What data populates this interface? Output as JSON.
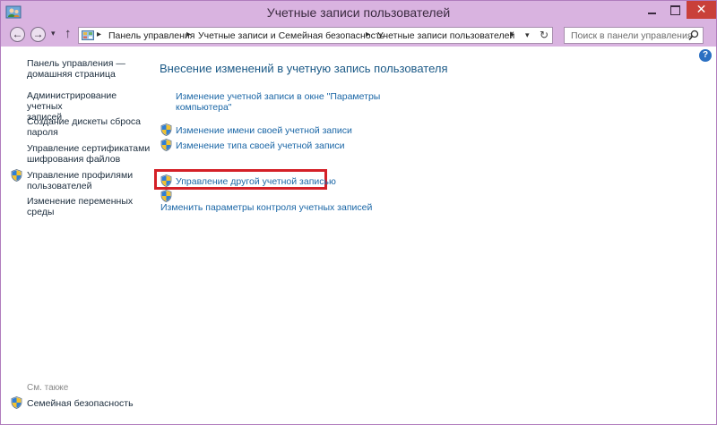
{
  "window": {
    "title": "Учетные записи пользователей",
    "close_glyph": "✕",
    "icons": {
      "app": "control-panel-users-icon",
      "minimize": "minimize-icon",
      "maximize": "maximize-icon",
      "close": "close-icon"
    }
  },
  "navbar": {
    "back_glyph": "←",
    "forward_glyph": "→",
    "history_glyph": "▾",
    "up_glyph": "↑",
    "address": {
      "breadcrumbs": [
        "Панель управления",
        "Учетные записи и Семейная безопасность",
        "Учетные записи пользователей"
      ],
      "separator": "▸",
      "dropdown_glyph": "▾",
      "refresh_glyph": "↻"
    },
    "search": {
      "placeholder": "Поиск в панели управления"
    }
  },
  "sidebar": {
    "home": {
      "line1": "Панель управления —",
      "line2": "домашняя страница"
    },
    "links": [
      {
        "line1": "Администрирование учетных",
        "line2": "записей"
      },
      {
        "line1": "Создание дискеты сброса",
        "line2": "пароля"
      },
      {
        "line1": "Управление сертификатами",
        "line2": "шифрования файлов"
      },
      {
        "line1": "Управление профилями",
        "line2": "пользователей"
      },
      {
        "line1": "Изменение переменных",
        "line2": "среды"
      }
    ],
    "see_also": "См. также",
    "family_safety": "Семейная безопасность"
  },
  "main": {
    "heading": "Внесение изменений в учетную запись пользователя",
    "settings_link": {
      "line1": "Изменение учетной записи в окне \"Параметры",
      "line2": "компьютера\""
    },
    "change_name": "Изменение имени своей учетной записи",
    "change_type": "Изменение типа своей учетной записи",
    "manage_other": "Управление другой учетной записью",
    "uac_settings": "Изменить параметры контроля учетных записей"
  },
  "help": {
    "glyph": "?"
  },
  "colors": {
    "titlebar": "#d9b3e0",
    "link": "#1a66a6",
    "heading": "#1c5a87",
    "highlight": "#d42027",
    "close_button": "#c9403a"
  }
}
